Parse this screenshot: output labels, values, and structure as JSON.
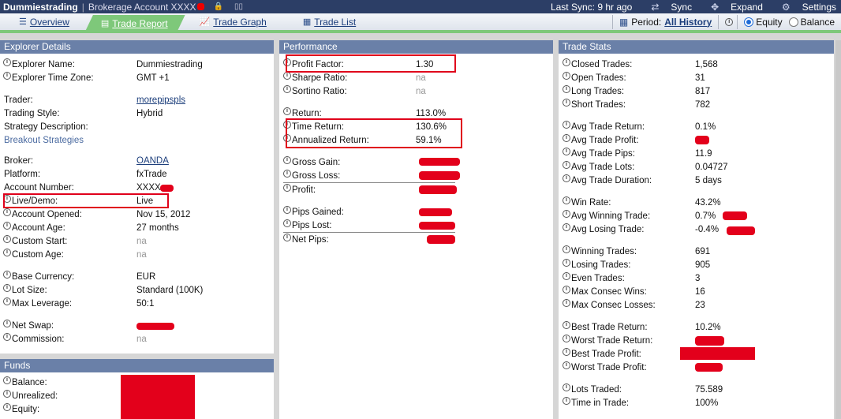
{
  "topbar": {
    "app_name": "Dummiestrading",
    "separator": "|",
    "account": "Brokerage Account XXXX",
    "lock_icon": "lock-icon",
    "last_sync": "Last Sync: 9 hr ago",
    "sync": "Sync",
    "expand": "Expand",
    "settings": "Settings"
  },
  "tabs": [
    {
      "label": "Overview",
      "icon": "overview-icon"
    },
    {
      "label": "Trade Report",
      "icon": "report-icon",
      "active": true
    },
    {
      "label": "Trade Graph",
      "icon": "graph-icon"
    },
    {
      "label": "Trade List",
      "icon": "list-icon"
    }
  ],
  "period": {
    "label": "Period:",
    "value": "All History",
    "equity": "Equity",
    "balance": "Balance",
    "selected": "Equity"
  },
  "explorer": {
    "title": "Explorer Details",
    "name_label": "Explorer Name:",
    "name_value": "Dummiestrading",
    "tz_label": "Explorer Time Zone:",
    "tz_value": "GMT +1",
    "trader_label": "Trader:",
    "trader_value": "morepipspls",
    "style_label": "Trading Style:",
    "style_value": "Hybrid",
    "desc_label": "Strategy Description:",
    "desc_value": "Breakout Strategies",
    "broker_label": "Broker:",
    "broker_value": "OANDA",
    "platform_label": "Platform:",
    "platform_value": "fxTrade",
    "accnum_label": "Account Number:",
    "accnum_value": "XXXX",
    "live_label": "Live/Demo:",
    "live_value": "Live",
    "opened_label": "Account Opened:",
    "opened_value": "Nov 15, 2012",
    "age_label": "Account Age:",
    "age_value": "27 months",
    "cstart_label": "Custom Start:",
    "cstart_value": "na",
    "cage_label": "Custom Age:",
    "cage_value": "na",
    "currency_label": "Base Currency:",
    "currency_value": "EUR",
    "lot_label": "Lot Size:",
    "lot_value": "Standard (100K)",
    "lev_label": "Max Leverage:",
    "lev_value": "50:1",
    "swap_label": "Net Swap:",
    "comm_label": "Commission:",
    "comm_value": "na"
  },
  "funds": {
    "title": "Funds",
    "balance_label": "Balance:",
    "unrealized_label": "Unrealized:",
    "equity_label": "Equity:"
  },
  "performance": {
    "title": "Performance",
    "pf_label": "Profit Factor:",
    "pf_value": "1.30",
    "sharpe_label": "Sharpe Ratio:",
    "sharpe_value": "na",
    "sortino_label": "Sortino Ratio:",
    "sortino_value": "na",
    "return_label": "Return:",
    "return_value": "113.0%",
    "time_label": "Time Return:",
    "time_value": "130.6%",
    "ann_label": "Annualized Return:",
    "ann_value": "59.1%",
    "gain_label": "Gross Gain:",
    "loss_label": "Gross Loss:",
    "profit_label": "Profit:",
    "pgained_label": "Pips Gained:",
    "plost_label": "Pips Lost:",
    "pnet_label": "Net Pips:"
  },
  "stats": {
    "title": "Trade Stats",
    "closed_label": "Closed Trades:",
    "closed_value": "1,568",
    "open_label": "Open Trades:",
    "open_value": "31",
    "long_label": "Long Trades:",
    "long_value": "817",
    "short_label": "Short Trades:",
    "short_value": "782",
    "avgret_label": "Avg Trade Return:",
    "avgret_value": "0.1%",
    "avgprof_label": "Avg Trade Profit:",
    "avgpips_label": "Avg Trade Pips:",
    "avgpips_value": "11.9",
    "avglots_label": "Avg Trade Lots:",
    "avglots_value": "0.04727",
    "avgdur_label": "Avg Trade Duration:",
    "avgdur_value": "5 days",
    "winrate_label": "Win Rate:",
    "winrate_value": "43.2%",
    "avgwin_label": "Avg Winning Trade:",
    "avgwin_value": "0.7%",
    "avglose_label": "Avg Losing Trade:",
    "avglose_value": "-0.4%",
    "wins_label": "Winning Trades:",
    "wins_value": "691",
    "losses_label": "Losing Trades:",
    "losses_value": "905",
    "even_label": "Even Trades:",
    "even_value": "3",
    "maxwins_label": "Max Consec Wins:",
    "maxwins_value": "16",
    "maxlosses_label": "Max Consec Losses:",
    "maxlosses_value": "23",
    "bestret_label": "Best Trade Return:",
    "bestret_value": "10.2%",
    "worstret_label": "Worst Trade Return:",
    "bestprof_label": "Best Trade Profit:",
    "worstprof_label": "Worst Trade Profit:",
    "lots_label": "Lots Traded:",
    "lots_value": "75.589",
    "tit_label": "Time in Trade:",
    "tit_value": "100%"
  },
  "colors": {
    "header_bg": "#2c3e66",
    "panel_head": "#6a80a8",
    "active_tab": "#7ec87a",
    "highlight_box": "#e0001b",
    "redaction": "#e3001b"
  }
}
